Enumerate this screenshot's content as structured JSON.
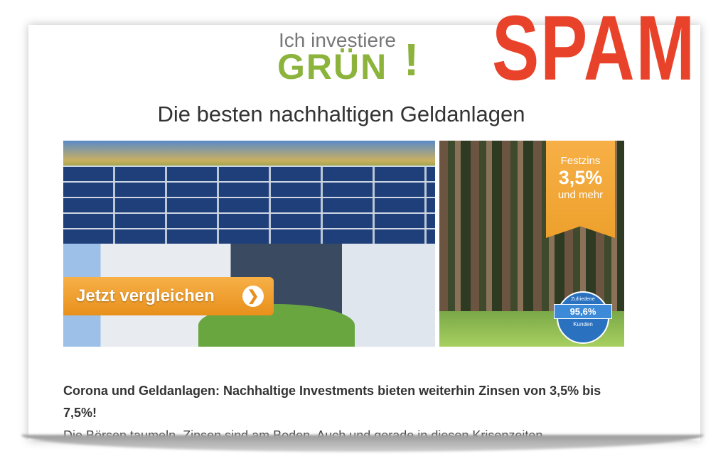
{
  "stamp": "SPAM",
  "logo": {
    "line1": "Ich investiere",
    "line2": "GRÜN",
    "exclamation": "!"
  },
  "title": "Die besten nachhaltigen Geldanlagen",
  "cta": {
    "label": "Jetzt vergleichen",
    "icon": "chevron-right-icon"
  },
  "ribbon": {
    "label": "Festzins",
    "rate": "3,5%",
    "suffix": "und mehr"
  },
  "badge": {
    "top": "Zufriedene",
    "value": "95,6%",
    "bottom": "Kunden"
  },
  "headline": "Corona und Geldanlagen: Nachhaltige Investments bieten weiterhin Zinsen von 3,5% bis 7,5%!",
  "body": "Die Börsen taumeln, Zinsen sind am Boden. Auch und gerade in diesen Krisenzeiten",
  "colors": {
    "stamp": "#e8432a",
    "brand_green": "#8cb43c",
    "accent_orange": "#f0a030",
    "badge_blue": "#2a72c0"
  }
}
